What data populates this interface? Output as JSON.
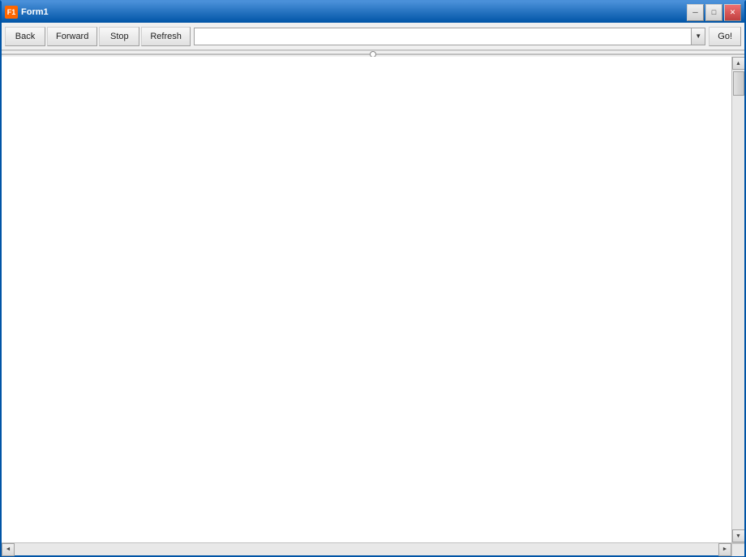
{
  "window": {
    "title": "Form1",
    "icon_label": "F1"
  },
  "title_buttons": {
    "minimize_label": "─",
    "maximize_label": "□",
    "close_label": "✕"
  },
  "toolbar": {
    "back_label": "Back",
    "forward_label": "Forward",
    "stop_label": "Stop",
    "refresh_label": "Refresh",
    "go_label": "Go!",
    "url_placeholder": "",
    "url_value": ""
  },
  "scrollbar": {
    "up_arrow": "▲",
    "down_arrow": "▼",
    "left_arrow": "◄",
    "right_arrow": "►"
  }
}
